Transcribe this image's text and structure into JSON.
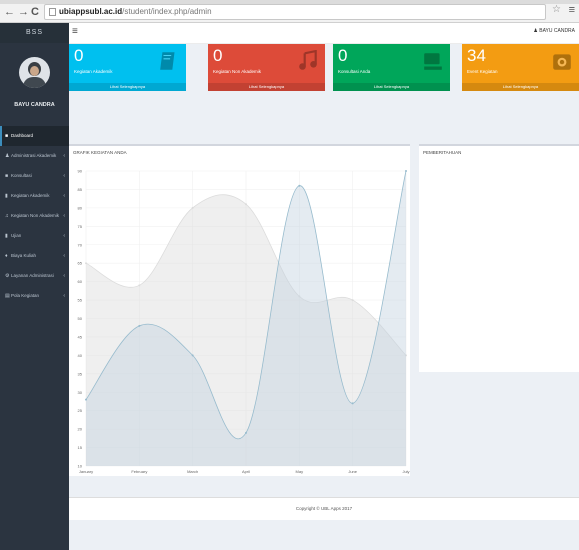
{
  "browser": {
    "url_host": "ubiappsubl.ac.id",
    "url_path": "/student/index.php/admin"
  },
  "sidebar": {
    "brand": "BSS",
    "user_name": "BAYU CANDRA",
    "items": [
      {
        "label": "Dashboard",
        "icon": "dashboard-icon"
      },
      {
        "label": "Administrasi Akademik",
        "icon": "user-icon"
      },
      {
        "label": "Konsultasi",
        "icon": "comments-icon"
      },
      {
        "label": "Kegiatan Akademik",
        "icon": "book-icon"
      },
      {
        "label": "Kegiatan Non Akademik",
        "icon": "music-icon"
      },
      {
        "label": "Ujian",
        "icon": "file-icon"
      },
      {
        "label": "Biaya Kuliah",
        "icon": "money-icon"
      },
      {
        "label": "Layanan Administrasi",
        "icon": "gear-icon"
      },
      {
        "label": "Pola Kegiatan",
        "icon": "sitemap-icon"
      }
    ]
  },
  "topbar": {
    "user": "BAYU CANDRA"
  },
  "boxes": [
    {
      "value": "0",
      "label": "Kegiatan Akademik",
      "link": "Lihat Selengkapnya",
      "color": "#00c0ef",
      "icon": "book-icon"
    },
    {
      "value": "0",
      "label": "Kegiatan Non Akademik",
      "link": "Lihat Selengkapnya",
      "color": "#dd4b39",
      "icon": "music-icon"
    },
    {
      "value": "0",
      "label": "Konsultasi Anda",
      "link": "Lihat Selengkapnya",
      "color": "#00a65a",
      "icon": "comments-icon"
    },
    {
      "value": "34",
      "label": "Event Kegiatan",
      "link": "Lihat Selengkapnya",
      "color": "#f39c12",
      "icon": "calendar-icon"
    }
  ],
  "chart_panel": {
    "title": "GRAFIK KEGIATAN ANDA"
  },
  "announce_panel": {
    "title": "PEMBERITAHUAN"
  },
  "chart_data": {
    "type": "line",
    "categories": [
      "January",
      "February",
      "March",
      "April",
      "May",
      "June",
      "July"
    ],
    "ylim": [
      10,
      90
    ],
    "yticks": [
      10,
      15,
      20,
      25,
      30,
      35,
      40,
      45,
      50,
      55,
      60,
      65,
      70,
      75,
      80,
      85,
      90
    ],
    "series": [
      {
        "fill": "#dcdcdc",
        "stroke": "#dcdcdc",
        "values": [
          65,
          59,
          80,
          81,
          56,
          55,
          40
        ]
      },
      {
        "fill": "#c3d3e0",
        "stroke": "#97bbcd",
        "values": [
          28,
          48,
          40,
          19,
          86,
          27,
          90
        ]
      }
    ]
  },
  "footer": {
    "text": "Copyright © UBL Apps 2017"
  }
}
